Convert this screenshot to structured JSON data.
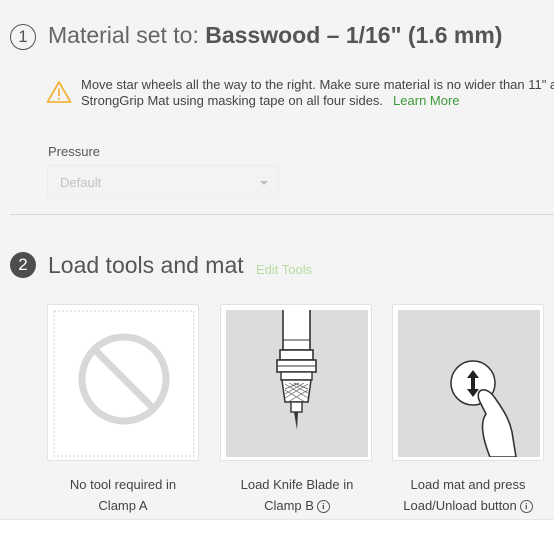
{
  "step1": {
    "number": "1",
    "title_prefix": "Material set to: ",
    "material": "Basswood – 1/16\" (1.6 mm)",
    "warning_line1": "Move star wheels all the way to the right. Make sure material is no wider than 11\" a",
    "warning_line2": "StrongGrip Mat using masking tape on all four sides.",
    "learn_more": "Learn More",
    "pressure_label": "Pressure",
    "pressure_value": "Default"
  },
  "step2": {
    "number": "2",
    "title": "Load tools and mat",
    "edit_tools": "Edit Tools",
    "cards": [
      {
        "line1": "No tool required in",
        "line2": "Clamp A"
      },
      {
        "line1": "Load Knife Blade in",
        "line2": "Clamp B",
        "info": "i"
      },
      {
        "line1": "Load mat and press",
        "line2": "Load/Unload button",
        "info": "i"
      }
    ]
  },
  "icons": [
    "warning-icon",
    "chevron-down-icon",
    "no-tool-icon",
    "knife-blade-icon",
    "load-unload-button-icon",
    "info-icon"
  ]
}
